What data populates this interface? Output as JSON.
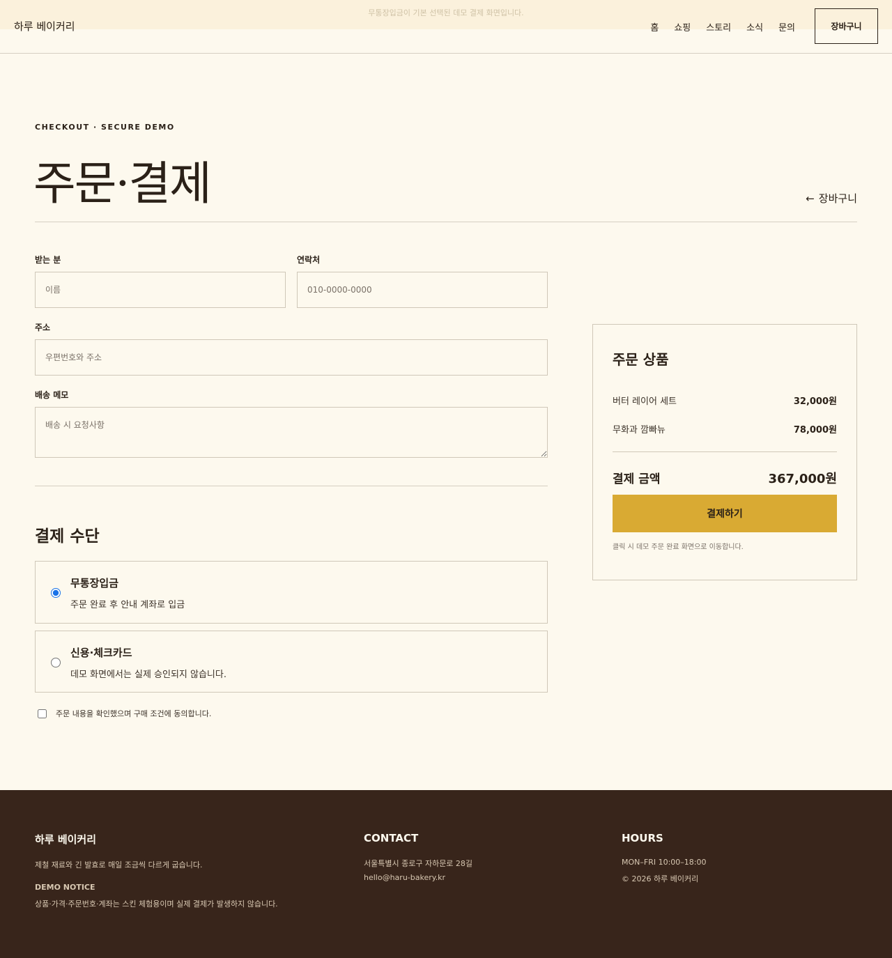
{
  "notice": "무통장입금이 기본 선택된 데모 결제 화면입니다.",
  "header": {
    "brand": "하루 베이커리",
    "nav": [
      "홈",
      "쇼핑",
      "스토리",
      "소식",
      "문의"
    ],
    "cart_label": "장바구니"
  },
  "page": {
    "eyebrow": "CHECKOUT · SECURE DEMO",
    "title": "주문·결제",
    "back_label": "장바구니"
  },
  "form": {
    "recipient_label": "받는 분",
    "recipient_placeholder": "이름",
    "phone_label": "연락처",
    "phone_placeholder": "010-0000-0000",
    "address_label": "주소",
    "address_placeholder": "우편번호와 주소",
    "memo_label": "배송 메모",
    "memo_placeholder": "배송 시 요청사항"
  },
  "payment": {
    "section_title": "결제 수단",
    "options": [
      {
        "title": "무통장입금",
        "desc": "주문 완료 후 안내 계좌로 입금",
        "selected": true
      },
      {
        "title": "신용·체크카드",
        "desc": "데모 화면에서는 실제 승인되지 않습니다.",
        "selected": false
      }
    ],
    "agree_text": "주문 내용을 확인했으며 구매 조건에 동의합니다."
  },
  "summary": {
    "title": "주문 상품",
    "items": [
      {
        "name": "버터 레이어 세트",
        "price": "32,000원"
      },
      {
        "name": "무화과 깜빠뉴",
        "price": "78,000원"
      }
    ],
    "total_label": "결제 금액",
    "total_value": "367,000원",
    "pay_button": "결제하기",
    "note": "클릭 시 데모 주문 완료 화면으로 이동합니다."
  },
  "footer": {
    "brand": "하루 베이커리",
    "tagline": "제철 재료와 긴 발효로 매일 조금씩 다르게 굽습니다.",
    "demo_heading": "DEMO NOTICE",
    "demo_text": "상품·가격·주문번호·계좌는 스킨 체험용이며 실제 결제가 발생하지 않습니다.",
    "contact_heading": "CONTACT",
    "address": "서울특별시 종로구 자하문로 28길",
    "email": "hello@haru-bakery.kr",
    "hours_heading": "HOURS",
    "hours": "MON–FRI 10:00–18:00",
    "copyright": "© 2026 하루 베이커리"
  },
  "colors": {
    "background": "#fdf9ee",
    "text": "#2b2118",
    "accent": "#d9aa33",
    "footer": "#38251b"
  }
}
